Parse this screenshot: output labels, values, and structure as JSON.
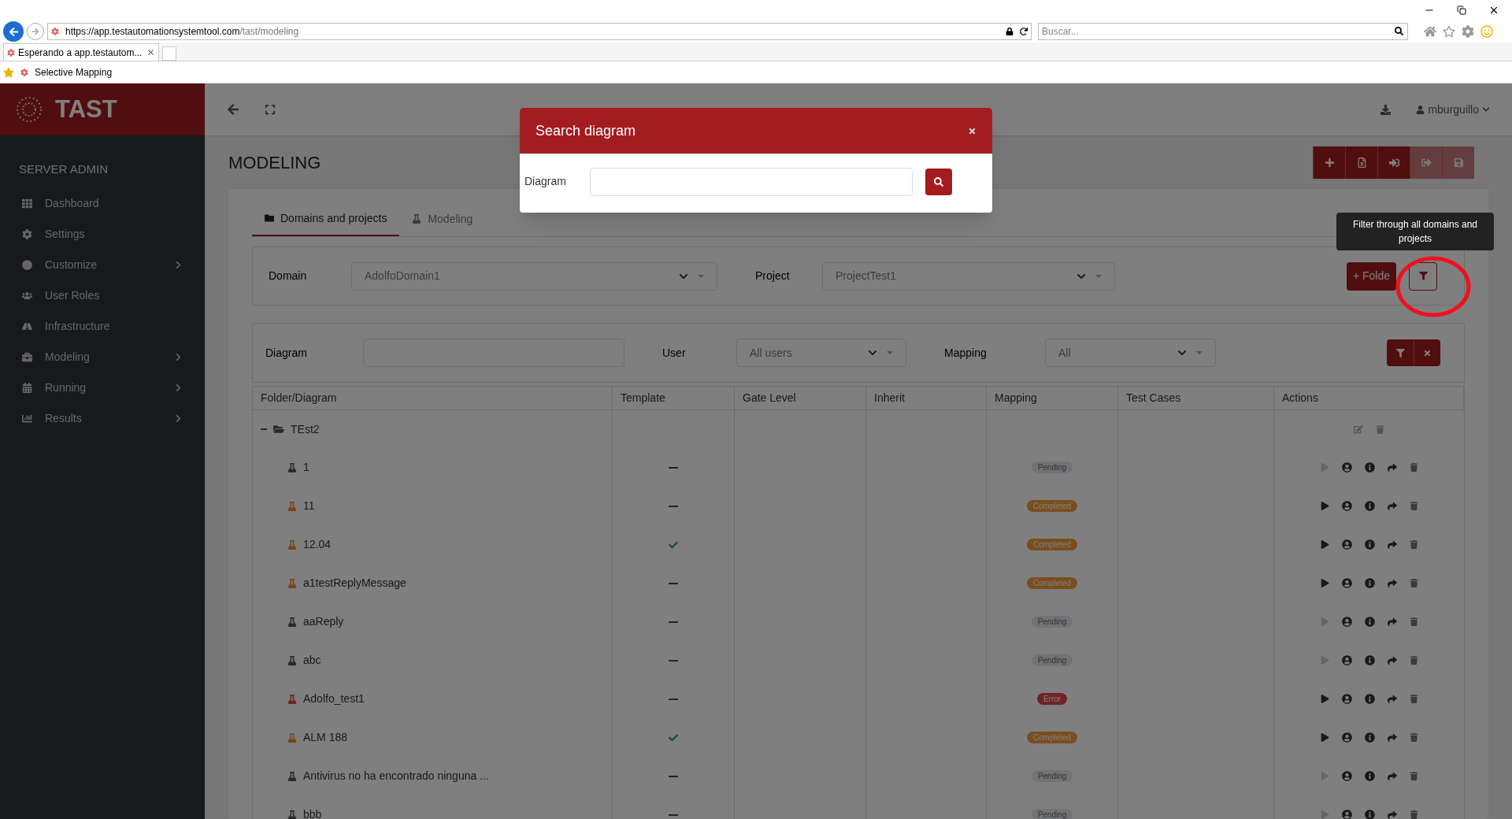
{
  "browser": {
    "url_host": "https://app.testautomationsystemtool.com",
    "url_path": "/tast/modeling",
    "search_placeholder": "Buscar...",
    "tab_title": "Esperando a app.testautom...",
    "favorite": "Selective Mapping"
  },
  "app": {
    "logo": "TAST",
    "user": "mburguillo"
  },
  "sidebar": {
    "heading": "SERVER ADMIN",
    "items": [
      {
        "label": "Dashboard",
        "expandable": false
      },
      {
        "label": "Settings",
        "expandable": false
      },
      {
        "label": "Customize",
        "expandable": true
      },
      {
        "label": "User Roles",
        "expandable": false
      },
      {
        "label": "Infrastructure",
        "expandable": false
      },
      {
        "label": "Modeling",
        "expandable": true
      },
      {
        "label": "Running",
        "expandable": true
      },
      {
        "label": "Results",
        "expandable": true
      }
    ]
  },
  "page": {
    "title": "MODELING"
  },
  "toolbar": [
    {
      "kind": "add",
      "disabled": false
    },
    {
      "kind": "excel",
      "disabled": false
    },
    {
      "kind": "import",
      "disabled": false
    },
    {
      "kind": "export",
      "disabled": true
    },
    {
      "kind": "save",
      "disabled": true
    }
  ],
  "tabs": [
    {
      "label": "Domains and projects",
      "selected": true
    },
    {
      "label": "Modeling",
      "selected": false
    }
  ],
  "domain_panel": {
    "domain_label": "Domain",
    "domain_value": "AdolfoDomain1",
    "project_label": "Project",
    "project_value": "ProjectTest1",
    "folder_button": "+ Folde"
  },
  "tooltip": "Filter through all domains and projects",
  "filters": {
    "diagram_label": "Diagram",
    "user_label": "User",
    "user_value": "All users",
    "mapping_label": "Mapping",
    "mapping_value": "All"
  },
  "table": {
    "columns": [
      "Folder/Diagram",
      "Template",
      "Gate Level",
      "Inherit",
      "Mapping",
      "Test Cases",
      "Actions"
    ],
    "folder": {
      "name": "TEst2",
      "expanded": true
    },
    "rows": [
      {
        "name": "1",
        "template": false,
        "mapping": {
          "label": "Pending",
          "kind": "pending"
        }
      },
      {
        "name": "11",
        "template": false,
        "mapping": {
          "label": "Completed",
          "kind": "completed"
        }
      },
      {
        "name": "12.04",
        "template": true,
        "mapping": {
          "label": "Completed",
          "kind": "completed"
        }
      },
      {
        "name": "a1testReplyMessage",
        "template": false,
        "mapping": {
          "label": "Completed",
          "kind": "completed"
        }
      },
      {
        "name": "aaReply",
        "template": false,
        "mapping": {
          "label": "Pending",
          "kind": "pending"
        }
      },
      {
        "name": "abc",
        "template": false,
        "mapping": {
          "label": "Pending",
          "kind": "pending"
        }
      },
      {
        "name": "Adolfo_test1",
        "template": false,
        "mapping": {
          "label": "Error",
          "kind": "error"
        }
      },
      {
        "name": "ALM 188",
        "template": true,
        "mapping": {
          "label": "Completed",
          "kind": "completed"
        }
      },
      {
        "name": "Antivirus no ha encontrado ninguna ...",
        "template": false,
        "mapping": {
          "label": "Pending",
          "kind": "pending"
        }
      },
      {
        "name": "bbb",
        "template": false,
        "mapping": {
          "label": "Pending",
          "kind": "pending"
        }
      }
    ]
  },
  "modal": {
    "title": "Search diagram",
    "field_label": "Diagram"
  }
}
